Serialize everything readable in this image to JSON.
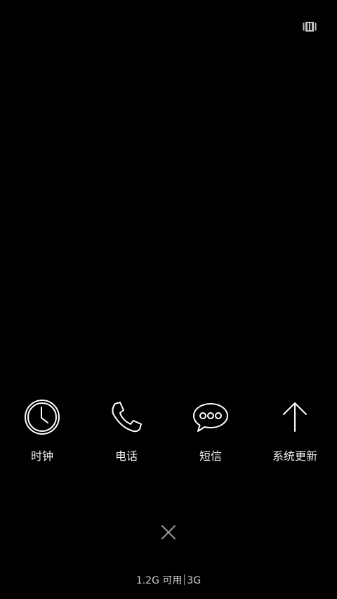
{
  "top_icon": "task-manager-icon",
  "apps": [
    {
      "label": "时钟",
      "icon": "clock-icon"
    },
    {
      "label": "电话",
      "icon": "phone-icon"
    },
    {
      "label": "短信",
      "icon": "message-icon"
    },
    {
      "label": "系统更新",
      "icon": "up-arrow-icon"
    }
  ],
  "close_icon": "close-icon",
  "memory": {
    "available": "1.2G 可用",
    "network": "3G"
  }
}
